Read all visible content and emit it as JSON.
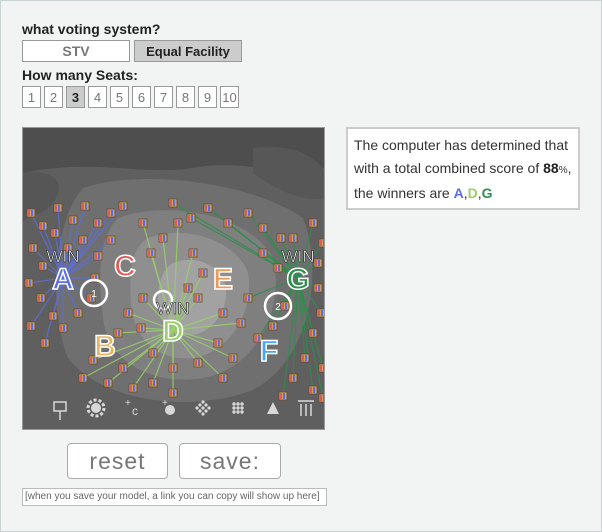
{
  "system_prompt": "what voting system?",
  "systems": [
    {
      "label": "STV",
      "selected": false
    },
    {
      "label": "Equal Facility",
      "selected": true
    }
  ],
  "seats_prompt": "How many Seats:",
  "seats": [
    "1",
    "2",
    "3",
    "4",
    "5",
    "6",
    "7",
    "8",
    "9",
    "10"
  ],
  "selected_seat": "3",
  "caption": {
    "line1": "The computer has determined that with a total combined score of ",
    "score": "88",
    "unit": "%",
    "line2": ", the winners are ",
    "winners": [
      "A",
      "D",
      "G"
    ],
    "sep": ","
  },
  "candidates": [
    {
      "letter": "A",
      "color": "#5b6ee0",
      "win": true
    },
    {
      "letter": "B",
      "color": "#e8b45c",
      "win": false
    },
    {
      "letter": "C",
      "color": "#e05b57",
      "win": false
    },
    {
      "letter": "D",
      "color": "#9ad06a",
      "win": true
    },
    {
      "letter": "E",
      "color": "#e89a5b",
      "win": false
    },
    {
      "letter": "F",
      "color": "#4aa6e8",
      "win": false
    },
    {
      "letter": "G",
      "color": "#2c8f4c",
      "win": true
    }
  ],
  "win_label": "WIN",
  "district_markers": [
    "1",
    "2"
  ],
  "toolbar_icons": [
    "move-icon",
    "gear-icon",
    "add-candidate-icon",
    "add-voter-icon",
    "dots-cluster-icon",
    "dots-grid-icon",
    "triangle-icon",
    "columns-icon"
  ],
  "buttons": {
    "reset": "reset",
    "save": "save:"
  },
  "link_placeholder": "[when you save your model, a link you can copy will show up here]"
}
